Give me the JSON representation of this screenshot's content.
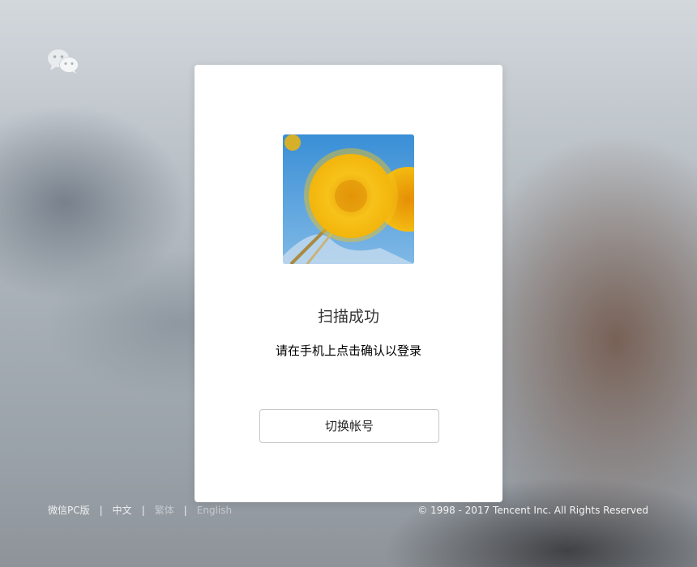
{
  "logo": {
    "icon": "wechat-logo-icon"
  },
  "card": {
    "avatar": {
      "icon": "dandelion-avatar-image"
    },
    "title": "扫描成功",
    "subtitle": "请在手机上点击确认以登录",
    "switch_account_label": "切换帐号"
  },
  "footer": {
    "links": [
      "微信PC版",
      "中文",
      "繁体",
      "English"
    ],
    "separator": "|",
    "copyright": "© 1998 - 2017 Tencent Inc. All Rights Reserved"
  }
}
